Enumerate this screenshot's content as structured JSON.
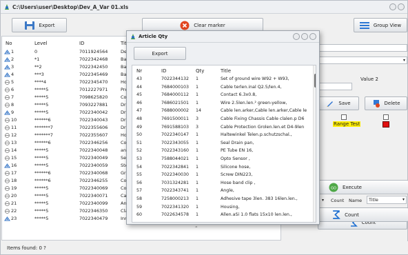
{
  "window": {
    "title": "C:\\Users\\user\\Desktop\\Dev_A_Var 01.xls"
  },
  "toolbar": {
    "export_label": "Export",
    "clear_marker_label": "Clear marker",
    "group_view_label": "Group View"
  },
  "table": {
    "headers": {
      "no": "No",
      "level": "Level",
      "id": "ID",
      "title": "Titl"
    },
    "rows": [
      {
        "no": "1",
        "level": "0",
        "id": "7011924564",
        "title": "De"
      },
      {
        "no": "2",
        "level": "*1",
        "id": "7022342468",
        "title": "Bas"
      },
      {
        "no": "3",
        "level": "**2",
        "id": "7022342450",
        "title": "Bas"
      },
      {
        "no": "4",
        "level": "***3",
        "id": "7022345469",
        "title": "Bas"
      },
      {
        "no": "5",
        "level": "****4",
        "id": "7022345470",
        "title": "Ho"
      },
      {
        "no": "6",
        "level": "*****5",
        "id": "7012227971",
        "title": "Pre"
      },
      {
        "no": "7",
        "level": "*****5",
        "id": "7098625820",
        "title": "Co"
      },
      {
        "no": "8",
        "level": "*****5",
        "id": "7093227881",
        "title": "Dri"
      },
      {
        "no": "9",
        "level": "*****5",
        "id": "7022340042",
        "title": "Dri"
      },
      {
        "no": "10",
        "level": "******6",
        "id": "7022340043",
        "title": "Dri"
      },
      {
        "no": "11",
        "level": "*******7",
        "id": "7022355606",
        "title": "Dri"
      },
      {
        "no": "12",
        "level": "*******7",
        "id": "7022355607",
        "title": "Ho"
      },
      {
        "no": "13",
        "level": "******6",
        "id": "7022346256",
        "title": "Co"
      },
      {
        "no": "14",
        "level": "*****5",
        "id": "7022340048",
        "title": "ang"
      },
      {
        "no": "15",
        "level": "*****5",
        "id": "7022340049",
        "title": "Sep"
      },
      {
        "no": "16",
        "level": "*****5",
        "id": "7022340059",
        "title": "Ste"
      },
      {
        "no": "17",
        "level": "******6",
        "id": "7022340068",
        "title": "Gri"
      },
      {
        "no": "18",
        "level": "******6",
        "id": "7022346255",
        "title": "Co"
      },
      {
        "no": "19",
        "level": "*****5",
        "id": "7022340069",
        "title": "Co"
      },
      {
        "no": "20",
        "level": "*****5",
        "id": "7022340071",
        "title": "Ca"
      },
      {
        "no": "21",
        "level": "*****5",
        "id": "7022340099",
        "title": "An"
      },
      {
        "no": "22",
        "level": "*****5",
        "id": "7022346350",
        "title": "Cla"
      },
      {
        "no": "23",
        "level": "*****5",
        "id": "7022340479",
        "title": "Inne"
      }
    ]
  },
  "right_panel": {
    "value2_label": "Value 2",
    "save_label": "Save",
    "delete_label": "Delete",
    "range_test_label": "Range Test",
    "execute_label": "Execute",
    "count_label": "Count",
    "name_label": "Name",
    "name_select_value": "Title",
    "count_button_label": "Count",
    "colors": {
      "range_test_bg": "#ffee00",
      "red_box": "#e01010"
    }
  },
  "status": {
    "items_found": "Items found: 0  ?"
  },
  "dialog": {
    "title": "Article Qty",
    "export_label": "Export",
    "headers": {
      "nr": "Nr",
      "id": "ID",
      "qty": "Qty",
      "title": "Title"
    },
    "rows": [
      {
        "nr": "43",
        "id": "7022344132",
        "qty": "1",
        "title": "Set of ground wire W92 + W93,"
      },
      {
        "nr": "44",
        "id": "7684000103",
        "qty": "1",
        "title": "Cable terlen.inal Q2.5/len.4,"
      },
      {
        "nr": "45",
        "id": "7684000112",
        "qty": "1",
        "title": "Contact 6.3x0.8,"
      },
      {
        "nr": "46",
        "id": "7686021501",
        "qty": "1",
        "title": "Wire 2.5len.len.² green-yellow,"
      },
      {
        "nr": "47",
        "id": "7688000002",
        "qty": "14",
        "title": "Cable len.arker,Cable len.arker,Cable le"
      },
      {
        "nr": "48",
        "id": "7691500011",
        "qty": "3",
        "title": "Cable Fixing Chassis Cable clalen.p D6"
      },
      {
        "nr": "49",
        "id": "7691588103",
        "qty": "3",
        "title": "Cable Protection Grolen.len.et D4-9len"
      },
      {
        "nr": "50",
        "id": "7022340147",
        "qty": "1",
        "title": "Haltewinkel Telen.p.schutzschal.,"
      },
      {
        "nr": "51",
        "id": "7022343055",
        "qty": "1",
        "title": "Seal Drain pan,"
      },
      {
        "nr": "52",
        "id": "7022343160",
        "qty": "1",
        "title": "PE Tube  EN 16,"
      },
      {
        "nr": "53",
        "id": "7588044021",
        "qty": "1",
        "title": "Opto Sensor ,"
      },
      {
        "nr": "54",
        "id": "7022342841",
        "qty": "1",
        "title": "Silicone hose,"
      },
      {
        "nr": "55",
        "id": "7022340030",
        "qty": "1",
        "title": "Screw DIN223,"
      },
      {
        "nr": "56",
        "id": "7031324281",
        "qty": "1",
        "title": "Hose band clip ,"
      },
      {
        "nr": "57",
        "id": "7022343741",
        "qty": "1",
        "title": "Angle,"
      },
      {
        "nr": "58",
        "id": "7258000213",
        "qty": "1",
        "title": "Adhesive tape 3len.  383 16len.len.,"
      },
      {
        "nr": "59",
        "id": "7022341320",
        "qty": "1",
        "title": "Housing,"
      },
      {
        "nr": "60",
        "id": "7022634578",
        "qty": "1",
        "title": "Allen.aSi 1.0 flats 15x10 len.len.,"
      }
    ]
  }
}
